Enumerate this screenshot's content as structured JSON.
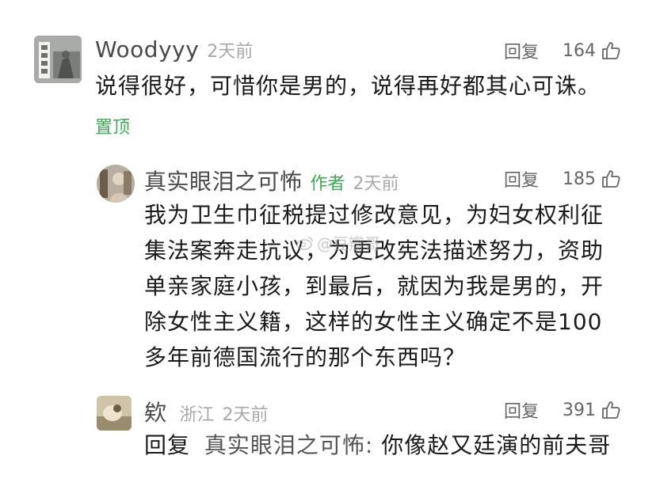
{
  "comments": [
    {
      "username": "Woodyyy",
      "time": "2天前",
      "reply_label": "回复",
      "likes": "164",
      "text": "说得很好，可惜你是男的，说得再好都其心可诛。",
      "pinned_label": "置顶"
    },
    {
      "username": "真实眼泪之可怖",
      "author_tag": "作者",
      "time": "2天前",
      "reply_label": "回复",
      "likes": "185",
      "text_lines": [
        "我为卫生巾征税提过修改意见，为妇女权利征",
        "集法案奔走抗议，为更改宪法描述努力，资助",
        "单亲家庭小孩，到最后，就因为我是男的，开",
        "除女性主义籍，这样的女性主义确定不是100",
        "多年前德国流行的那个东西吗？"
      ]
    },
    {
      "username": "欸",
      "location": "浙江",
      "time": "2天前",
      "reply_label": "回复",
      "likes": "391",
      "reply_prefix": "回复",
      "reply_target": "真实眼泪之可怖:",
      "text": "你像赵又廷演的前夫哥"
    }
  ],
  "watermark": "@豆瓣哥",
  "colors": {
    "accent_green": "#3daa55",
    "meta_gray": "#a8a8a8",
    "text": "#1a1a1a"
  },
  "icons": {
    "like": "thumbs-up-icon",
    "watermark": "weibo-icon"
  }
}
